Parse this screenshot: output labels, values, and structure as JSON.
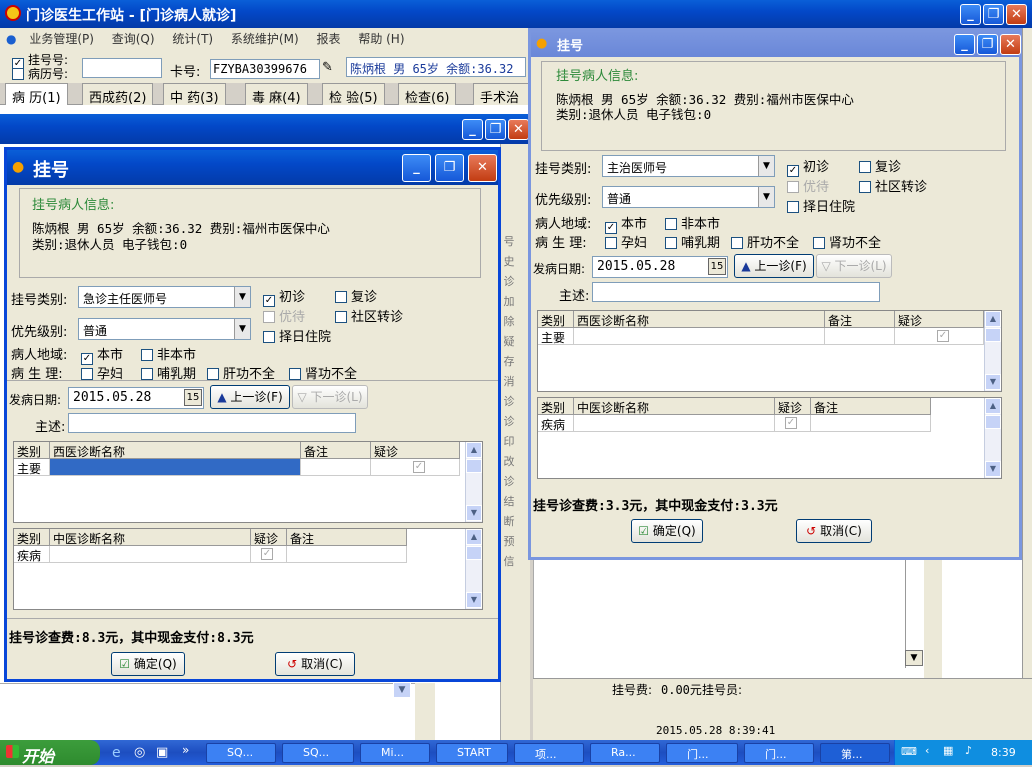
{
  "main_window": {
    "title": "门诊医生工作站 - [门诊病人就诊]",
    "menu": [
      "业务管理(P)",
      "查询(Q)",
      "统计(T)",
      "系统维护(M)",
      "报表",
      "帮助 (H)"
    ],
    "check_guahao": "挂号号:",
    "check_bingli": "病历号:",
    "card_label": "卡号:",
    "card_value": "FZYBA30399676",
    "patient_banner": "陈炳根 男 65岁 余额:36.32",
    "tabs": [
      "病 历(1)",
      "西成药(2)",
      "中 药(3)",
      "毒 麻(4)",
      "检 验(5)",
      "检查(6)",
      "手术治疗"
    ]
  },
  "dialog_a": {
    "title": "挂号",
    "info_heading": "挂号病人信息:",
    "info_line1": "陈炳根 男 65岁 余额:36.32 费别:福州市医保中心",
    "info_line2": "类别:退休人员 电子钱包:0",
    "type_label": "挂号类别:",
    "type_value": "急诊主任医师号",
    "priority_label": "优先级别:",
    "priority_value": "普通",
    "chk_first": "初诊",
    "chk_revisit": "复诊",
    "chk_preferential": "优待",
    "chk_community": "社区转诊",
    "chk_hospital": "择日住院",
    "region_label": "病人地域:",
    "chk_city": "本市",
    "chk_noncity": "非本市",
    "phys_label": "病 生 理:",
    "chk_pregnant": "孕妇",
    "chk_lactation": "哺乳期",
    "chk_liver": "肝功不全",
    "chk_kidney": "肾功不全",
    "onset_label": "发病日期:",
    "onset_value": "2015.05.28",
    "prev_button": "上一诊(F)",
    "next_button": "下一诊(L)",
    "complaint_label": "主述:",
    "west_headers": [
      "类别",
      "西医诊断名称",
      "备注",
      "疑诊"
    ],
    "west_row_category": "主要",
    "tcm_headers": [
      "类别",
      "中医诊断名称",
      "疑诊",
      "备注"
    ],
    "tcm_row_category": "疾病",
    "fee_text": "挂号诊查费:8.3元，其中现金支付:8.3元",
    "ok_button": "确定(Q)",
    "cancel_button": "取消(C)"
  },
  "dialog_b": {
    "title": "挂号",
    "info_heading": "挂号病人信息:",
    "info_line1": "陈炳根 男 65岁 余额:36.32 费别:福州市医保中心",
    "info_line2": "类别:退休人员 电子钱包:0",
    "type_label": "挂号类别:",
    "type_value": "主治医师号",
    "priority_label": "优先级别:",
    "priority_value": "普通",
    "chk_first": "初诊",
    "chk_revisit": "复诊",
    "chk_preferential": "优待",
    "chk_community": "社区转诊",
    "chk_hospital": "择日住院",
    "region_label": "病人地域:",
    "chk_city": "本市",
    "chk_noncity": "非本市",
    "phys_label": "病 生 理:",
    "chk_pregnant": "孕妇",
    "chk_lactation": "哺乳期",
    "chk_liver": "肝功不全",
    "chk_kidney": "肾功不全",
    "onset_label": "发病日期:",
    "onset_value": "2015.05.28",
    "prev_button": "上一诊(F)",
    "next_button": "下一诊(L)",
    "complaint_label": "主述:",
    "west_headers": [
      "类别",
      "西医诊断名称",
      "备注",
      "疑诊"
    ],
    "west_row_category": "主要",
    "tcm_headers": [
      "类别",
      "中医诊断名称",
      "疑诊",
      "备注"
    ],
    "tcm_row_category": "疾病",
    "fee_text": "挂号诊查费:3.3元，其中现金支付:3.3元",
    "ok_button": "确定(Q)",
    "cancel_button": "取消(C)"
  },
  "side_letters": [
    "号",
    "史",
    "诊",
    "加",
    "除",
    "疑",
    "存",
    "消",
    "诊",
    "诊",
    "印",
    "改",
    "诊",
    "结",
    "断",
    "预",
    "信"
  ],
  "status": {
    "fee_label": "挂号费:",
    "fee_value": "0.00元",
    "operator_label": "挂号员:",
    "datetime": "2015.05.28 8:39:41"
  },
  "taskbar": {
    "start": "开始",
    "items": [
      "SQ...",
      "SQ...",
      "Mi...",
      "START",
      "项...",
      "Ra...",
      "门...",
      "门...",
      "第..."
    ],
    "clock": "8:39"
  },
  "colors": {
    "title_blue": "#0348c8",
    "heading_green": "#2d8a3a",
    "selection_blue": "#316ac5"
  }
}
